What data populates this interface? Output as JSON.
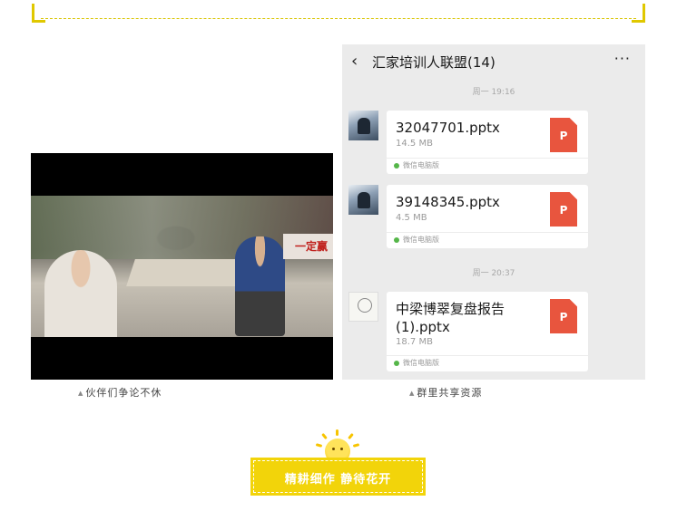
{
  "left_panel": {
    "video_overlay_text": "一定赢",
    "caption": "伙伴们争论不休"
  },
  "right_panel": {
    "chat": {
      "back_icon": "chevron-left-icon",
      "title": "汇家培训人联盟(14)",
      "more_icon": "more-dots-icon",
      "more_label": "···"
    },
    "messages": [
      {
        "time": "周一 19:16"
      },
      {
        "file_name": "32047701.pptx",
        "size": "14.5 MB",
        "file_icon": "P",
        "source": "微信电脑版"
      },
      {
        "file_name": "39148345.pptx",
        "size": "4.5 MB",
        "file_icon": "P",
        "source": "微信电脑版"
      },
      {
        "time": "周一 20:37"
      },
      {
        "file_name_line1": "中梁博翠复盘报告",
        "file_name_line2": "(1).pptx",
        "size": "18.7 MB",
        "file_icon": "P",
        "source": "微信电脑版"
      }
    ],
    "caption": "群里共享资源"
  },
  "caption_marker": "▲",
  "motto": "精耕细作 静待花开",
  "colors": {
    "accent_yellow": "#f2d40a",
    "ppt_orange": "#e8553e",
    "chat_bg": "#ebebeb",
    "wechat_green": "#55b649"
  }
}
